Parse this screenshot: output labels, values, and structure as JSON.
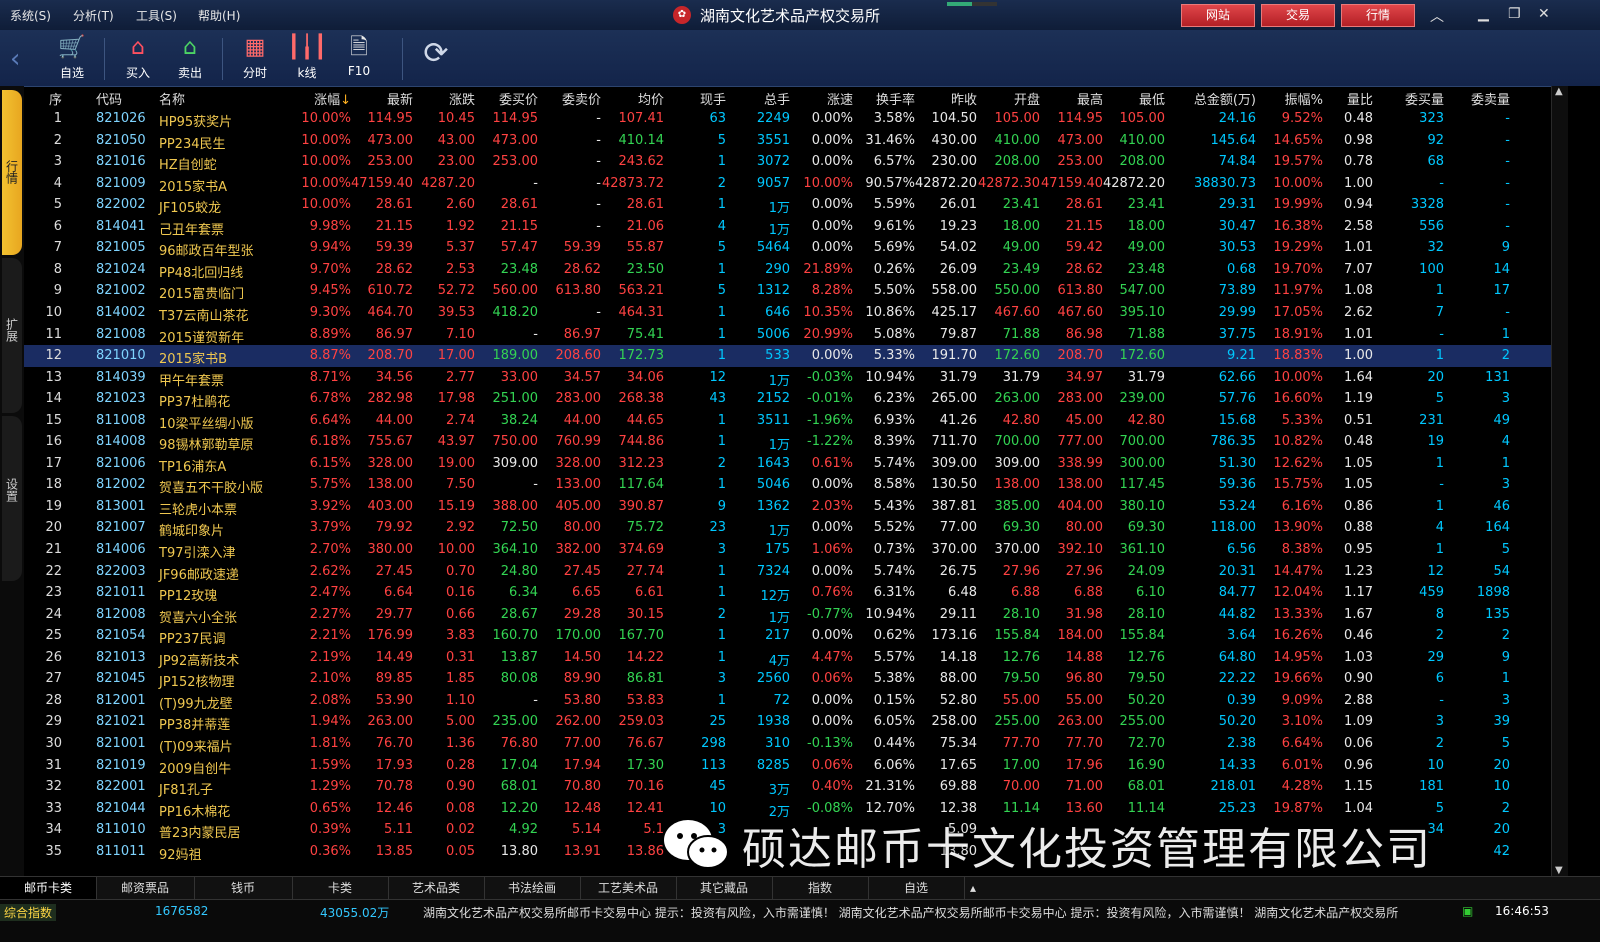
{
  "menu": [
    "系统(S)",
    "分析(T)",
    "工具(S)",
    "帮助(H)"
  ],
  "title": "湖南文化艺术品产权交易所",
  "top_buttons": [
    "网站",
    "交易",
    "行情"
  ],
  "download_progress": 0.5,
  "toolbar": [
    {
      "label": "自选",
      "icon": "cart-icon"
    },
    {
      "label": "买入",
      "icon": "buy-icon"
    },
    {
      "label": "卖出",
      "icon": "sell-icon"
    },
    {
      "label": "分时",
      "icon": "timeshare-icon"
    },
    {
      "label": "k线",
      "icon": "kline-icon"
    },
    {
      "label": "F10",
      "icon": "f10-icon"
    }
  ],
  "side_tabs": [
    "行情",
    "扩展",
    "设置"
  ],
  "headers": [
    "序",
    "代码",
    "名称",
    "涨幅",
    "最新",
    "涨跌",
    "委买价",
    "委卖价",
    "均价",
    "现手",
    "总手",
    "涨速",
    "换手率",
    "昨收",
    "开盘",
    "最高",
    "最低",
    "总金额(万)",
    "振幅%",
    "量比",
    "委买量",
    "委卖量"
  ],
  "sort_indicator": "↓",
  "rows": [
    [
      "1",
      "821026",
      "HP95获奖片",
      "10.00%",
      "114.95",
      "10.45",
      "114.95",
      "-",
      "107.41",
      "63",
      "2249",
      "0.00%",
      "3.58%",
      "104.50",
      "105.00",
      "114.95",
      "105.00",
      "24.16",
      "9.52%",
      "0.48",
      "323",
      "-"
    ],
    [
      "2",
      "821050",
      "PP234民生",
      "10.00%",
      "473.00",
      "43.00",
      "473.00",
      "-",
      "410.14",
      "5",
      "3551",
      "0.00%",
      "31.46%",
      "430.00",
      "410.00",
      "473.00",
      "410.00",
      "145.64",
      "14.65%",
      "0.98",
      "92",
      "-"
    ],
    [
      "3",
      "821016",
      "HZ自创蛇",
      "10.00%",
      "253.00",
      "23.00",
      "253.00",
      "-",
      "243.62",
      "1",
      "3072",
      "0.00%",
      "6.57%",
      "230.00",
      "208.00",
      "253.00",
      "208.00",
      "74.84",
      "19.57%",
      "0.78",
      "68",
      "-"
    ],
    [
      "4",
      "821009",
      "2015家书A",
      "10.00%",
      "47159.40",
      "4287.20",
      "-",
      "-",
      "42873.72",
      "2",
      "9057",
      "10.00%",
      "90.57%",
      "42872.20",
      "42872.30",
      "47159.40",
      "42872.20",
      "38830.73",
      "10.00%",
      "1.00",
      "-",
      "-"
    ],
    [
      "5",
      "822002",
      "JF105蛟龙",
      "10.00%",
      "28.61",
      "2.60",
      "28.61",
      "-",
      "28.61",
      "1",
      "1万",
      "0.00%",
      "5.59%",
      "26.01",
      "23.41",
      "28.61",
      "23.41",
      "29.31",
      "19.99%",
      "0.94",
      "3328",
      "-"
    ],
    [
      "6",
      "814041",
      "己丑年套票",
      "9.98%",
      "21.15",
      "1.92",
      "21.15",
      "-",
      "21.06",
      "4",
      "1万",
      "0.00%",
      "9.61%",
      "19.23",
      "18.00",
      "21.15",
      "18.00",
      "30.47",
      "16.38%",
      "2.58",
      "556",
      "-"
    ],
    [
      "7",
      "821005",
      "96邮政百年型张",
      "9.94%",
      "59.39",
      "5.37",
      "57.47",
      "59.39",
      "55.87",
      "5",
      "5464",
      "0.00%",
      "5.69%",
      "54.02",
      "49.00",
      "59.42",
      "49.00",
      "30.53",
      "19.29%",
      "1.01",
      "32",
      "9"
    ],
    [
      "8",
      "821024",
      "PP48北回归线",
      "9.70%",
      "28.62",
      "2.53",
      "23.48",
      "28.62",
      "23.50",
      "1",
      "290",
      "21.89%",
      "0.26%",
      "26.09",
      "23.49",
      "28.62",
      "23.48",
      "0.68",
      "19.70%",
      "7.07",
      "100",
      "14"
    ],
    [
      "9",
      "821002",
      "2015富贵临门",
      "9.45%",
      "610.72",
      "52.72",
      "560.00",
      "613.80",
      "563.21",
      "5",
      "1312",
      "8.28%",
      "5.50%",
      "558.00",
      "550.00",
      "613.80",
      "547.00",
      "73.89",
      "11.97%",
      "1.08",
      "1",
      "17"
    ],
    [
      "10",
      "814002",
      "T37云南山茶花",
      "9.30%",
      "464.70",
      "39.53",
      "418.20",
      "-",
      "464.31",
      "1",
      "646",
      "10.35%",
      "10.86%",
      "425.17",
      "467.60",
      "467.60",
      "395.10",
      "29.99",
      "17.05%",
      "2.62",
      "7",
      "-"
    ],
    [
      "11",
      "821008",
      "2015谨贺新年",
      "8.89%",
      "86.97",
      "7.10",
      "-",
      "86.97",
      "75.41",
      "1",
      "5006",
      "20.99%",
      "5.08%",
      "79.87",
      "71.88",
      "86.98",
      "71.88",
      "37.75",
      "18.91%",
      "1.01",
      "-",
      "1"
    ],
    [
      "12",
      "821010",
      "2015家书B",
      "8.87%",
      "208.70",
      "17.00",
      "189.00",
      "208.60",
      "172.73",
      "1",
      "533",
      "0.00%",
      "5.33%",
      "191.70",
      "172.60",
      "208.70",
      "172.60",
      "9.21",
      "18.83%",
      "1.00",
      "1",
      "2"
    ],
    [
      "13",
      "814039",
      "甲午年套票",
      "8.71%",
      "34.56",
      "2.77",
      "33.00",
      "34.57",
      "34.06",
      "12",
      "1万",
      "-0.03%",
      "10.94%",
      "31.79",
      "31.79",
      "34.97",
      "31.79",
      "62.66",
      "10.00%",
      "1.64",
      "20",
      "131"
    ],
    [
      "14",
      "821023",
      "PP37杜鹃花",
      "6.78%",
      "282.98",
      "17.98",
      "251.00",
      "283.00",
      "268.38",
      "43",
      "2152",
      "-0.01%",
      "6.23%",
      "265.00",
      "263.00",
      "283.00",
      "239.00",
      "57.76",
      "16.60%",
      "1.19",
      "5",
      "3"
    ],
    [
      "15",
      "811008",
      "10梁平丝绸小版",
      "6.64%",
      "44.00",
      "2.74",
      "38.24",
      "44.00",
      "44.65",
      "1",
      "3511",
      "-1.96%",
      "6.93%",
      "41.26",
      "42.80",
      "45.00",
      "42.80",
      "15.68",
      "5.33%",
      "0.51",
      "231",
      "49"
    ],
    [
      "16",
      "814008",
      "98锡林郭勒草原",
      "6.18%",
      "755.67",
      "43.97",
      "750.00",
      "760.99",
      "744.86",
      "1",
      "1万",
      "-1.22%",
      "8.39%",
      "711.70",
      "700.00",
      "777.00",
      "700.00",
      "786.35",
      "10.82%",
      "0.48",
      "19",
      "4"
    ],
    [
      "17",
      "821006",
      "TP16浦东A",
      "6.15%",
      "328.00",
      "19.00",
      "309.00",
      "328.00",
      "312.23",
      "2",
      "1643",
      "0.61%",
      "5.74%",
      "309.00",
      "309.00",
      "338.99",
      "300.00",
      "51.30",
      "12.62%",
      "1.05",
      "1",
      "1"
    ],
    [
      "18",
      "812002",
      "贺喜五不干胶小版",
      "5.75%",
      "138.00",
      "7.50",
      "-",
      "133.00",
      "117.64",
      "1",
      "5046",
      "0.00%",
      "8.58%",
      "130.50",
      "138.00",
      "138.00",
      "117.45",
      "59.36",
      "15.75%",
      "1.05",
      "-",
      "3"
    ],
    [
      "19",
      "813001",
      "三轮虎小本票",
      "3.92%",
      "403.00",
      "15.19",
      "388.00",
      "405.00",
      "390.87",
      "9",
      "1362",
      "2.03%",
      "5.43%",
      "387.81",
      "385.00",
      "404.00",
      "380.10",
      "53.24",
      "6.16%",
      "0.86",
      "1",
      "46"
    ],
    [
      "20",
      "821007",
      "鹤城印象片",
      "3.79%",
      "79.92",
      "2.92",
      "72.50",
      "80.00",
      "75.72",
      "23",
      "1万",
      "0.00%",
      "5.52%",
      "77.00",
      "69.30",
      "80.00",
      "69.30",
      "118.00",
      "13.90%",
      "0.88",
      "4",
      "164"
    ],
    [
      "21",
      "814006",
      "T97引滦入津",
      "2.70%",
      "380.00",
      "10.00",
      "364.10",
      "382.00",
      "374.69",
      "3",
      "175",
      "1.06%",
      "0.73%",
      "370.00",
      "370.00",
      "392.10",
      "361.10",
      "6.56",
      "8.38%",
      "0.95",
      "1",
      "5"
    ],
    [
      "22",
      "822003",
      "JF96邮政速递",
      "2.62%",
      "27.45",
      "0.70",
      "24.80",
      "27.45",
      "27.74",
      "1",
      "7324",
      "0.00%",
      "5.74%",
      "26.75",
      "27.96",
      "27.96",
      "24.09",
      "20.31",
      "14.47%",
      "1.23",
      "12",
      "54"
    ],
    [
      "23",
      "821011",
      "PP12玫瑰",
      "2.47%",
      "6.64",
      "0.16",
      "6.34",
      "6.65",
      "6.61",
      "1",
      "12万",
      "0.76%",
      "6.31%",
      "6.48",
      "6.88",
      "6.88",
      "6.10",
      "84.77",
      "12.04%",
      "1.17",
      "459",
      "1898"
    ],
    [
      "24",
      "812008",
      "贺喜六小全张",
      "2.27%",
      "29.77",
      "0.66",
      "28.67",
      "29.28",
      "30.15",
      "2",
      "1万",
      "-0.77%",
      "10.94%",
      "29.11",
      "28.10",
      "31.98",
      "28.10",
      "44.82",
      "13.33%",
      "1.67",
      "8",
      "135"
    ],
    [
      "25",
      "821054",
      "PP237民调",
      "2.21%",
      "176.99",
      "3.83",
      "160.70",
      "170.00",
      "167.70",
      "1",
      "217",
      "0.00%",
      "0.62%",
      "173.16",
      "155.84",
      "184.00",
      "155.84",
      "3.64",
      "16.26%",
      "0.46",
      "2",
      "2"
    ],
    [
      "26",
      "821013",
      "JP92高新技术",
      "2.19%",
      "14.49",
      "0.31",
      "13.87",
      "14.50",
      "14.22",
      "1",
      "4万",
      "4.47%",
      "5.57%",
      "14.18",
      "12.76",
      "14.88",
      "12.76",
      "64.80",
      "14.95%",
      "1.03",
      "29",
      "9"
    ],
    [
      "27",
      "821045",
      "JP152核物理",
      "2.10%",
      "89.85",
      "1.85",
      "80.08",
      "89.90",
      "86.81",
      "3",
      "2560",
      "0.06%",
      "5.38%",
      "88.00",
      "79.50",
      "96.80",
      "79.50",
      "22.22",
      "19.66%",
      "0.90",
      "6",
      "1"
    ],
    [
      "28",
      "812001",
      "(T)99九龙壁",
      "2.08%",
      "53.90",
      "1.10",
      "-",
      "53.80",
      "53.83",
      "1",
      "72",
      "0.00%",
      "0.15%",
      "52.80",
      "55.00",
      "55.00",
      "50.20",
      "0.39",
      "9.09%",
      "2.88",
      "-",
      "3"
    ],
    [
      "29",
      "821021",
      "PP38并蒂莲",
      "1.94%",
      "263.00",
      "5.00",
      "235.00",
      "262.00",
      "259.03",
      "25",
      "1938",
      "0.00%",
      "6.05%",
      "258.00",
      "255.00",
      "263.00",
      "255.00",
      "50.20",
      "3.10%",
      "1.09",
      "3",
      "39"
    ],
    [
      "30",
      "821001",
      "(T)09来福片",
      "1.81%",
      "76.70",
      "1.36",
      "76.80",
      "77.00",
      "76.67",
      "298",
      "310",
      "-0.13%",
      "0.44%",
      "75.34",
      "77.70",
      "77.70",
      "72.70",
      "2.38",
      "6.64%",
      "0.06",
      "2",
      "5"
    ],
    [
      "31",
      "821019",
      "2009自创牛",
      "1.59%",
      "17.93",
      "0.28",
      "17.04",
      "17.94",
      "17.30",
      "113",
      "8285",
      "0.06%",
      "6.06%",
      "17.65",
      "17.00",
      "17.96",
      "16.90",
      "14.33",
      "6.01%",
      "0.96",
      "10",
      "20"
    ],
    [
      "32",
      "822001",
      "JF81孔子",
      "1.29%",
      "70.78",
      "0.90",
      "68.01",
      "70.80",
      "70.16",
      "45",
      "3万",
      "0.40%",
      "21.31%",
      "69.88",
      "70.00",
      "71.00",
      "68.01",
      "218.01",
      "4.28%",
      "1.15",
      "181",
      "10"
    ],
    [
      "33",
      "821044",
      "PP16木棉花",
      "0.65%",
      "12.46",
      "0.08",
      "12.20",
      "12.48",
      "12.41",
      "10",
      "2万",
      "-0.08%",
      "12.70%",
      "12.38",
      "11.14",
      "13.60",
      "11.14",
      "25.23",
      "19.87%",
      "1.04",
      "5",
      "2"
    ],
    [
      "34",
      "811010",
      "普23内蒙民居",
      "0.39%",
      "5.11",
      "0.02",
      "4.92",
      "5.14",
      "5.1",
      "3",
      "",
      "",
      "",
      "5.09",
      "",
      "",
      "",
      "",
      "",
      "",
      "34",
      "20"
    ],
    [
      "35",
      "811011",
      "92妈祖",
      "0.36%",
      "13.85",
      "0.05",
      "13.80",
      "13.91",
      "13.86",
      "",
      "",
      "",
      "",
      "13.80",
      "",
      "",
      "",
      "",
      "",
      "",
      "",
      "42"
    ]
  ],
  "selected_row": 11,
  "bottom_tabs": [
    "邮币卡类",
    "邮资票品",
    "钱币",
    "卡类",
    "艺术品类",
    "书法绘画",
    "工艺美术品",
    "其它藏品",
    "指数",
    "自选"
  ],
  "status": {
    "label": "综合指数",
    "value1": "1676582",
    "value2": "43055.02万",
    "ticker": "湖南文化艺术品产权交易所邮币卡交易中心  提示：投资有风险，入市需谨慎！        湖南文化艺术品产权交易所邮币卡交易中心  提示：投资有风险，入市需谨慎！        湖南文化艺术品产权交易所",
    "time": "16:46:53"
  },
  "watermark": "硕达邮币卡文化投资管理有限公司",
  "colors": {
    "up": "#ff4242",
    "down": "#33d453",
    "code": "#7fd4ff",
    "name": "#f0c850",
    "selected": "#1a2c62"
  }
}
